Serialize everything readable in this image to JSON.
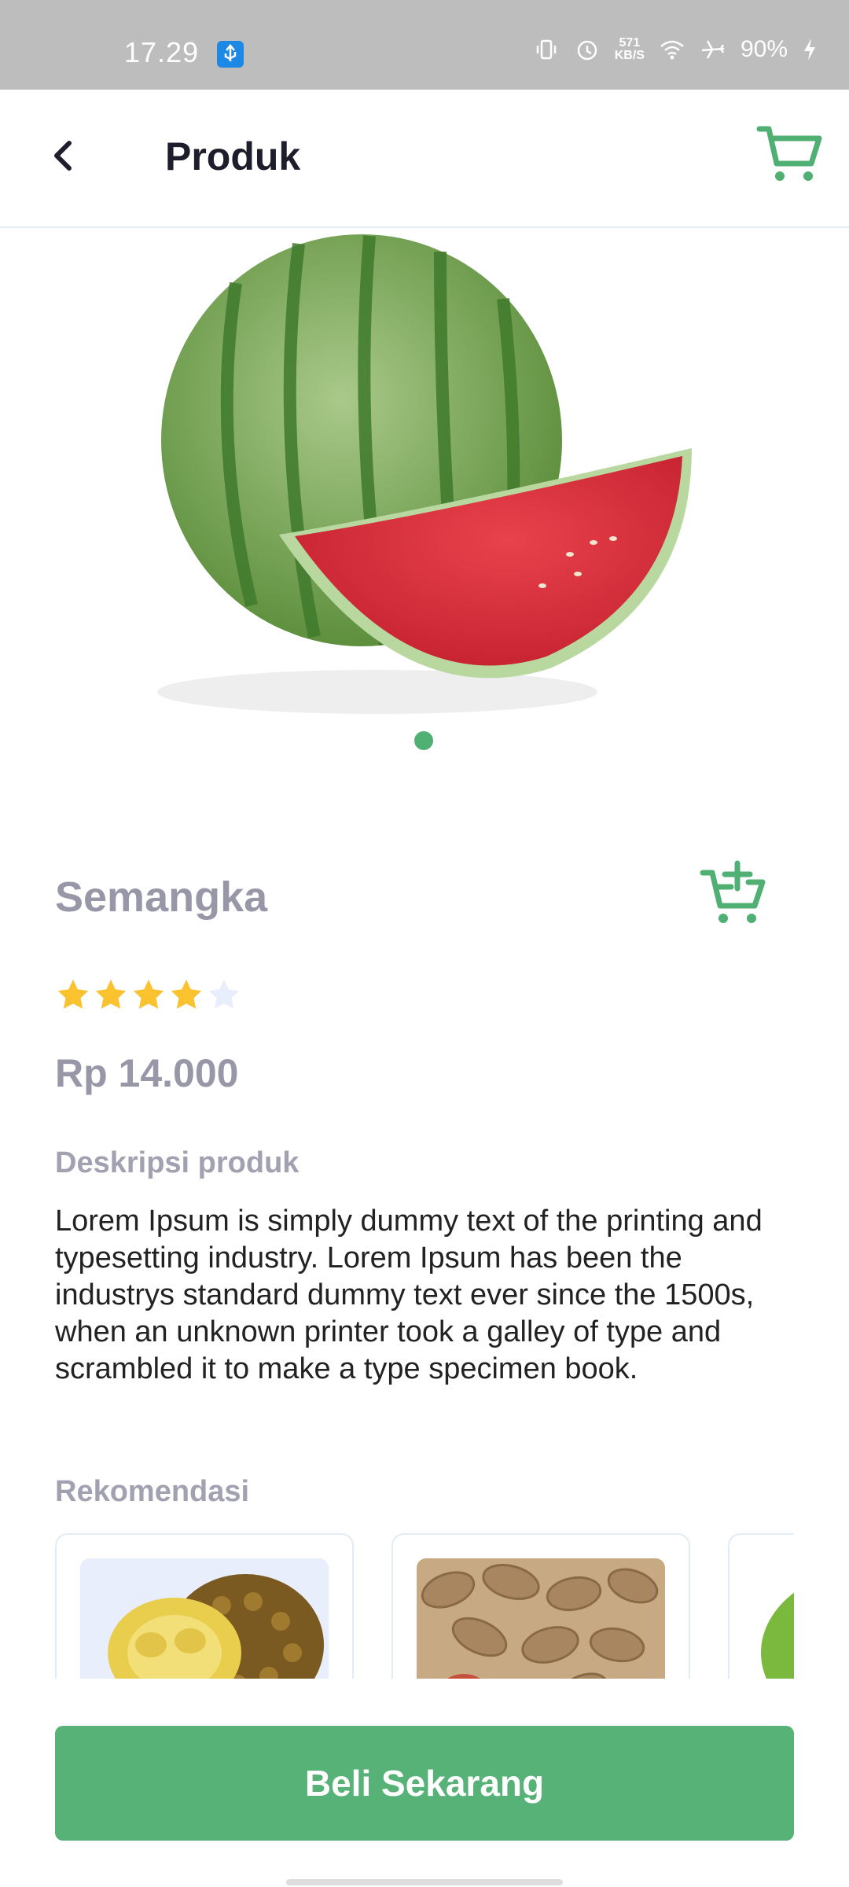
{
  "status_bar": {
    "time": "17.29",
    "speed_value": "571",
    "speed_unit": "KB/S",
    "battery": "90%",
    "icons": [
      "usb-icon",
      "vibrate-icon",
      "alarm-icon",
      "wifi-icon",
      "airplane-icon",
      "charging-icon"
    ]
  },
  "header": {
    "title": "Produk",
    "back_icon": "chevron-left-icon",
    "cart_icon": "cart-icon",
    "accent_color": "#50b073"
  },
  "product": {
    "image": "watermelon",
    "carousel_dots": 1,
    "name": "Semangka",
    "rating": 4,
    "rating_max": 5,
    "price": "Rp 14.000",
    "add_cart_icon": "cart-plus-icon",
    "description_label": "Deskripsi produk",
    "description": "Lorem Ipsum is simply dummy text of the printing and typesetting industry. Lorem Ipsum has been the industrys standard dummy text ever since the 1500s, when an unknown printer took a galley of type and scrambled it to make a type specimen book."
  },
  "recommendations": {
    "label": "Rekomendasi",
    "items": [
      {
        "image": "durian"
      },
      {
        "image": "peanuts"
      },
      {
        "image": "green-fruit"
      }
    ]
  },
  "buy_button": {
    "label": "Beli Sekarang",
    "color": "#56b276"
  }
}
